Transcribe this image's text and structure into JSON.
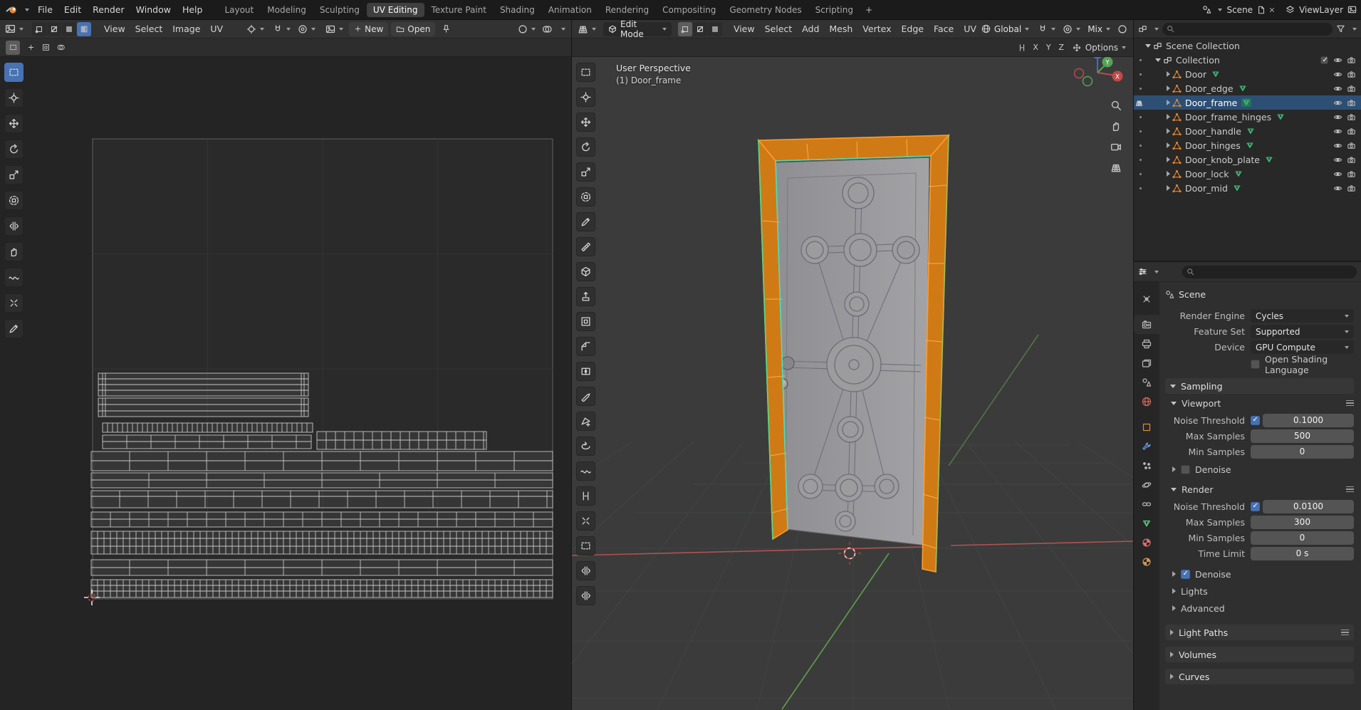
{
  "topbar": {
    "menus": [
      "File",
      "Edit",
      "Render",
      "Window",
      "Help"
    ],
    "tabs": [
      "Layout",
      "Modeling",
      "Sculpting",
      "UV Editing",
      "Texture Paint",
      "Shading",
      "Animation",
      "Rendering",
      "Compositing",
      "Geometry Nodes",
      "Scripting"
    ],
    "active_tab": "UV Editing",
    "new_workspace_label": "+",
    "scene_selector": {
      "label": "Scene"
    },
    "view_layer_selector": {
      "label": "ViewLayer"
    }
  },
  "uv_editor": {
    "menus": [
      "View",
      "Select",
      "Image",
      "UV"
    ],
    "buttons": {
      "new": "New",
      "open": "Open"
    },
    "select_mode_icons": [
      "uv-vertex-select-icon",
      "uv-edge-select-icon",
      "uv-face-select-icon",
      "uv-island-select-icon"
    ],
    "active_select_mode": "uv-island-select-icon",
    "tools": [
      "select-box",
      "cursor",
      "move",
      "rotate",
      "scale",
      "transform",
      "rip-region",
      "grab",
      "relax",
      "pinch",
      "annotate"
    ],
    "active_tool": "select-box"
  },
  "viewport": {
    "mode_label": "Edit Mode",
    "menus": [
      "View",
      "Select",
      "Add",
      "Mesh",
      "Vertex",
      "Edge",
      "Face",
      "UV"
    ],
    "orientation_label": "Global",
    "mix_label": "Mix",
    "select_mode_icons": [
      "vertex-select-icon",
      "edge-select-icon",
      "face-select-icon"
    ],
    "active_select_mode": "vertex-select-icon",
    "tool_settings": {
      "mirror_axes": [
        "X",
        "Y",
        "Z"
      ],
      "options_label": "Options"
    },
    "overlay": {
      "view_label": "User Perspective",
      "object_label": "(1) Door_frame"
    },
    "gizmo_axes": {
      "x": "X",
      "y": "Y",
      "z": "Z"
    },
    "tools": [
      "select-box",
      "cursor",
      "move",
      "rotate",
      "scale",
      "transform",
      "annotate",
      "measure",
      "add-cube",
      "extrude-region",
      "inset-faces",
      "bevel",
      "loop-cut",
      "knife",
      "poly-build",
      "spin",
      "smooth",
      "edge-slide",
      "shrink-flatten",
      "shear",
      "rip-region",
      "rip-edge"
    ]
  },
  "outliner": {
    "rows": [
      {
        "name": "Scene Collection",
        "type": "scene_collection",
        "expanded": true
      },
      {
        "name": "Collection",
        "type": "collection",
        "expanded": true,
        "checkbox": true
      },
      {
        "name": "Door",
        "type": "mesh"
      },
      {
        "name": "Door_edge",
        "type": "mesh"
      },
      {
        "name": "Door_frame",
        "type": "mesh",
        "selected": true,
        "active": true
      },
      {
        "name": "Door_frame_hinges",
        "type": "mesh"
      },
      {
        "name": "Door_handle",
        "type": "mesh"
      },
      {
        "name": "Door_hinges",
        "type": "mesh"
      },
      {
        "name": "Door_knob_plate",
        "type": "mesh"
      },
      {
        "name": "Door_lock",
        "type": "mesh"
      },
      {
        "name": "Door_mid",
        "type": "mesh"
      }
    ]
  },
  "properties": {
    "breadcrumb": "Scene",
    "render_engine": {
      "label": "Render Engine",
      "value": "Cycles"
    },
    "feature_set": {
      "label": "Feature Set",
      "value": "Supported"
    },
    "device": {
      "label": "Device",
      "value": "GPU Compute"
    },
    "osl": {
      "label": "Open Shading Language",
      "checked": false
    },
    "sampling": {
      "label": "Sampling",
      "viewport": {
        "label": "Viewport",
        "noise_threshold": {
          "label": "Noise Threshold",
          "checked": true,
          "value": "0.1000"
        },
        "max_samples": {
          "label": "Max Samples",
          "value": "500"
        },
        "min_samples": {
          "label": "Min Samples",
          "value": "0"
        },
        "denoise": {
          "label": "Denoise",
          "checked": false
        }
      },
      "render": {
        "label": "Render",
        "noise_threshold": {
          "label": "Noise Threshold",
          "checked": true,
          "value": "0.0100"
        },
        "max_samples": {
          "label": "Max Samples",
          "value": "300"
        },
        "min_samples": {
          "label": "Min Samples",
          "value": "0"
        },
        "time_limit": {
          "label": "Time Limit",
          "value": "0 s"
        },
        "denoise": {
          "label": "Denoise",
          "checked": true
        }
      },
      "lights_label": "Lights",
      "advanced_label": "Advanced"
    },
    "panels": [
      "Light Paths",
      "Volumes",
      "Curves"
    ],
    "tabs": [
      "tool",
      "render",
      "output",
      "view-layer",
      "scene",
      "world",
      "object",
      "modifiers",
      "particles",
      "physics",
      "constraints",
      "object-data",
      "material",
      "texture"
    ],
    "active_tab": "render"
  },
  "colors": {
    "accent": "#4772b3",
    "selection_row": "#2d4f74",
    "object_orange": "#e8862d",
    "mesh_data_green": "#3fbf77",
    "frame_selected_orange": "#ff9b2d",
    "seam_cyan": "#3fe0c4",
    "axis_x": "#b05252",
    "axis_y": "#5f9e4e",
    "axis_z": "#3b6fd0"
  }
}
